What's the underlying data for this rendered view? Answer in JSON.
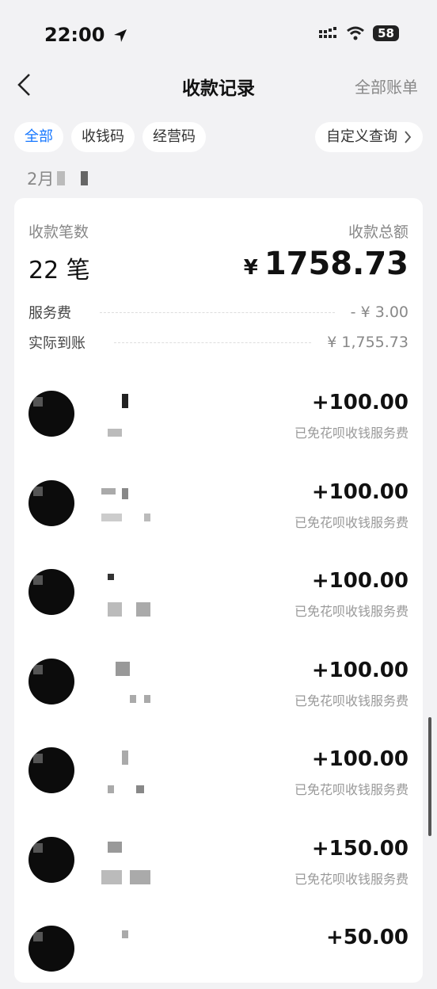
{
  "status_bar": {
    "time": "22:00",
    "battery": "58"
  },
  "nav": {
    "title": "收款记录",
    "right_link": "全部账单"
  },
  "filters": {
    "chips": [
      "全部",
      "收钱码",
      "经营码"
    ],
    "custom_query": "自定义查询"
  },
  "month": {
    "label": "2月"
  },
  "summary": {
    "count_label": "收款笔数",
    "total_label": "收款总额",
    "count_value": "22 笔",
    "currency_symbol": "¥",
    "total_value": "1758.73",
    "fee_label": "服务费",
    "fee_value": "- ¥ 3.00",
    "net_label": "实际到账",
    "net_value": "¥ 1,755.73"
  },
  "transactions": [
    {
      "amount": "+100.00",
      "note": "已免花呗收钱服务费"
    },
    {
      "amount": "+100.00",
      "note": "已免花呗收钱服务费"
    },
    {
      "amount": "+100.00",
      "note": "已免花呗收钱服务费"
    },
    {
      "amount": "+100.00",
      "note": "已免花呗收钱服务费"
    },
    {
      "amount": "+100.00",
      "note": "已免花呗收钱服务费"
    },
    {
      "amount": "+150.00",
      "note": "已免花呗收钱服务费"
    },
    {
      "amount": "+50.00",
      "note": ""
    }
  ]
}
